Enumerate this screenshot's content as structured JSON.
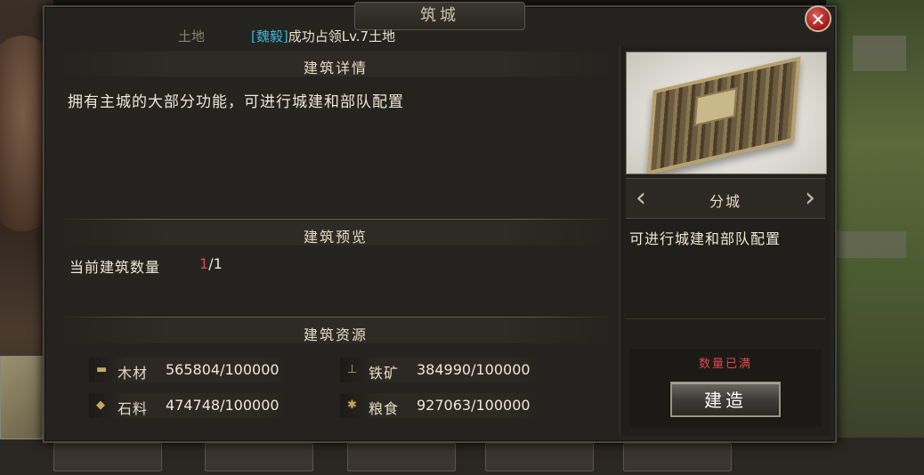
{
  "window": {
    "title": "筑城",
    "close_label": "✕"
  },
  "header": {
    "land_label": "土地",
    "tag": "[魏毅]",
    "message": "成功占领Lv.7土地"
  },
  "sections": {
    "detail": {
      "title": "建筑详情",
      "description": "拥有主城的大部分功能，可进行城建和部队配置"
    },
    "preview": {
      "title": "建筑预览",
      "count_label": "当前建筑数量",
      "count_current": "1",
      "count_total": "/1"
    },
    "resources": {
      "title": "建筑资源",
      "items": [
        {
          "icon": "wood-icon",
          "name": "木材",
          "value": "565804/100000"
        },
        {
          "icon": "iron-icon",
          "name": "铁矿",
          "value": "384990/100000"
        },
        {
          "icon": "stone-icon",
          "name": "石料",
          "value": "474748/100000"
        },
        {
          "icon": "grain-icon",
          "name": "粮食",
          "value": "927063/100000"
        }
      ]
    }
  },
  "building": {
    "type_name": "分城",
    "type_description": "可进行城建和部队配置",
    "prev_arrow": "‹",
    "next_arrow": "›",
    "status": "数量已满",
    "build_label": "建造"
  },
  "colors": {
    "status_red": "#d84848",
    "tag_blue": "#36b6d8"
  }
}
